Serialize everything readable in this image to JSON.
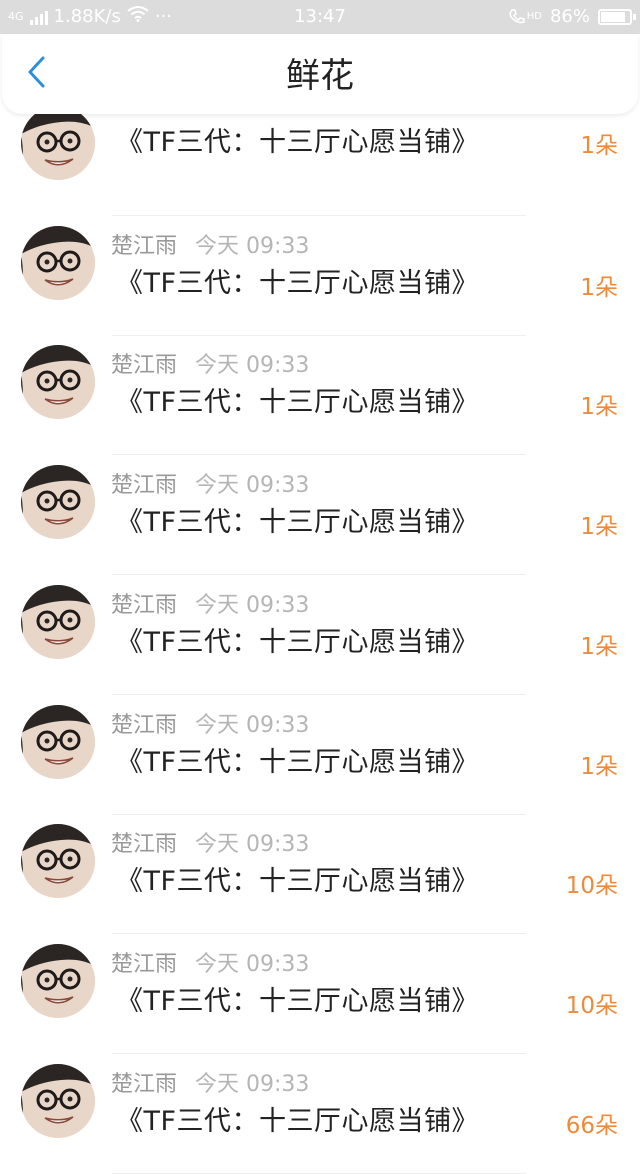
{
  "status_bar": {
    "network": "4G",
    "speed": "1.88K/s",
    "more": "···",
    "time": "13:47",
    "hd": "HD",
    "battery": "86%",
    "battery_level": 0.86
  },
  "header": {
    "title": "鲜花",
    "back_icon": "chevron-left-icon",
    "accent_color": "#2a8fe0"
  },
  "items": [
    {
      "sender": "",
      "time": "",
      "title": "《TF三代：十三厅心愿当铺》",
      "count": "1朵"
    },
    {
      "sender": "楚江雨",
      "time": "今天 09:33",
      "title": "《TF三代：十三厅心愿当铺》",
      "count": "1朵"
    },
    {
      "sender": "楚江雨",
      "time": "今天 09:33",
      "title": "《TF三代：十三厅心愿当铺》",
      "count": "1朵"
    },
    {
      "sender": "楚江雨",
      "time": "今天 09:33",
      "title": "《TF三代：十三厅心愿当铺》",
      "count": "1朵"
    },
    {
      "sender": "楚江雨",
      "time": "今天 09:33",
      "title": "《TF三代：十三厅心愿当铺》",
      "count": "1朵"
    },
    {
      "sender": "楚江雨",
      "time": "今天 09:33",
      "title": "《TF三代：十三厅心愿当铺》",
      "count": "1朵"
    },
    {
      "sender": "楚江雨",
      "time": "今天 09:33",
      "title": "《TF三代：十三厅心愿当铺》",
      "count": "10朵"
    },
    {
      "sender": "楚江雨",
      "time": "今天 09:33",
      "title": "《TF三代：十三厅心愿当铺》",
      "count": "10朵"
    },
    {
      "sender": "楚江雨",
      "time": "今天 09:33",
      "title": "《TF三代：十三厅心愿当铺》",
      "count": "66朵"
    }
  ],
  "colors": {
    "count": "#f08a3a",
    "meta": "#aaaaaa",
    "status_bar_bg": "#dcdcdc"
  }
}
